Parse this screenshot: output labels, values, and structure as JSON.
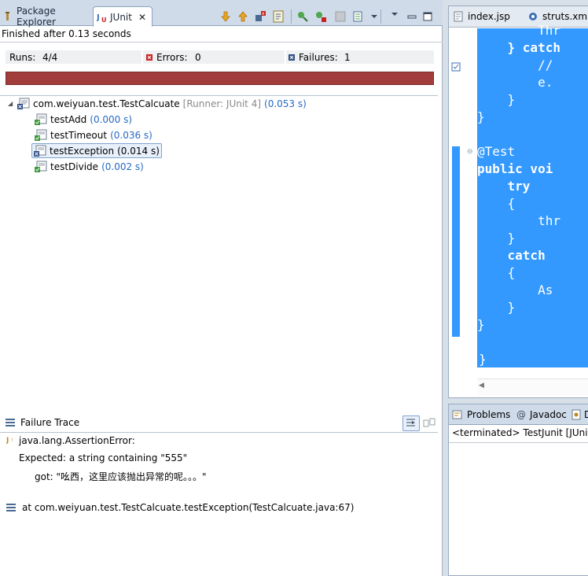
{
  "tabs": {
    "package_explorer": "Package Explorer",
    "junit": "JUnit"
  },
  "status": {
    "finished": "Finished after 0.13 seconds"
  },
  "stats": {
    "runs_label": "Runs:",
    "runs_value": "4/4",
    "errors_label": "Errors:",
    "errors_value": "0",
    "failures_label": "Failures:",
    "failures_value": "1"
  },
  "progress": {
    "fraction": 1.0,
    "color": "#a13d3b"
  },
  "tree": {
    "root": {
      "name": "com.weiyuan.test.TestCalcuate",
      "runner": "[Runner: JUnit 4]",
      "time": "(0.053 s)"
    },
    "tests": [
      {
        "name": "testAdd",
        "time": "(0.000 s)",
        "status": "passed"
      },
      {
        "name": "testTimeout",
        "time": "(0.036 s)",
        "status": "passed"
      },
      {
        "name": "testException",
        "time": "(0.014 s)",
        "status": "failed"
      },
      {
        "name": "testDivide",
        "time": "(0.002 s)",
        "status": "passed"
      }
    ]
  },
  "failure_trace": {
    "title": "Failure Trace",
    "lines": [
      "java.lang.AssertionError:",
      "Expected: a string containing \"555\"",
      "got: \"吆西，这里应该抛出异常的呢。。。\"",
      "at com.weiyuan.test.TestCalcuate.testException(TestCalcuate.java:67)"
    ]
  },
  "editor": {
    "tabs": [
      "index.jsp",
      "struts.xml"
    ],
    "code_lines": [
      "        Thr",
      "    } catch",
      "        //",
      "        e.",
      "    }",
      "}",
      "",
      "@Test",
      "public voi",
      "    try",
      "    {",
      "        thr",
      "    }",
      "    catch",
      "    {",
      "        As",
      "    }",
      "}",
      "",
      "}"
    ]
  },
  "bottom_panel": {
    "tabs": [
      "Problems",
      "Javadoc",
      "D"
    ],
    "console_line": "<terminated> TestJunit [JUnit]"
  },
  "colors": {
    "failure_bar": "#a13d3b",
    "selection": "#3399ff",
    "time_text": "#2768c5",
    "runner_text": "#8a8a8a"
  }
}
